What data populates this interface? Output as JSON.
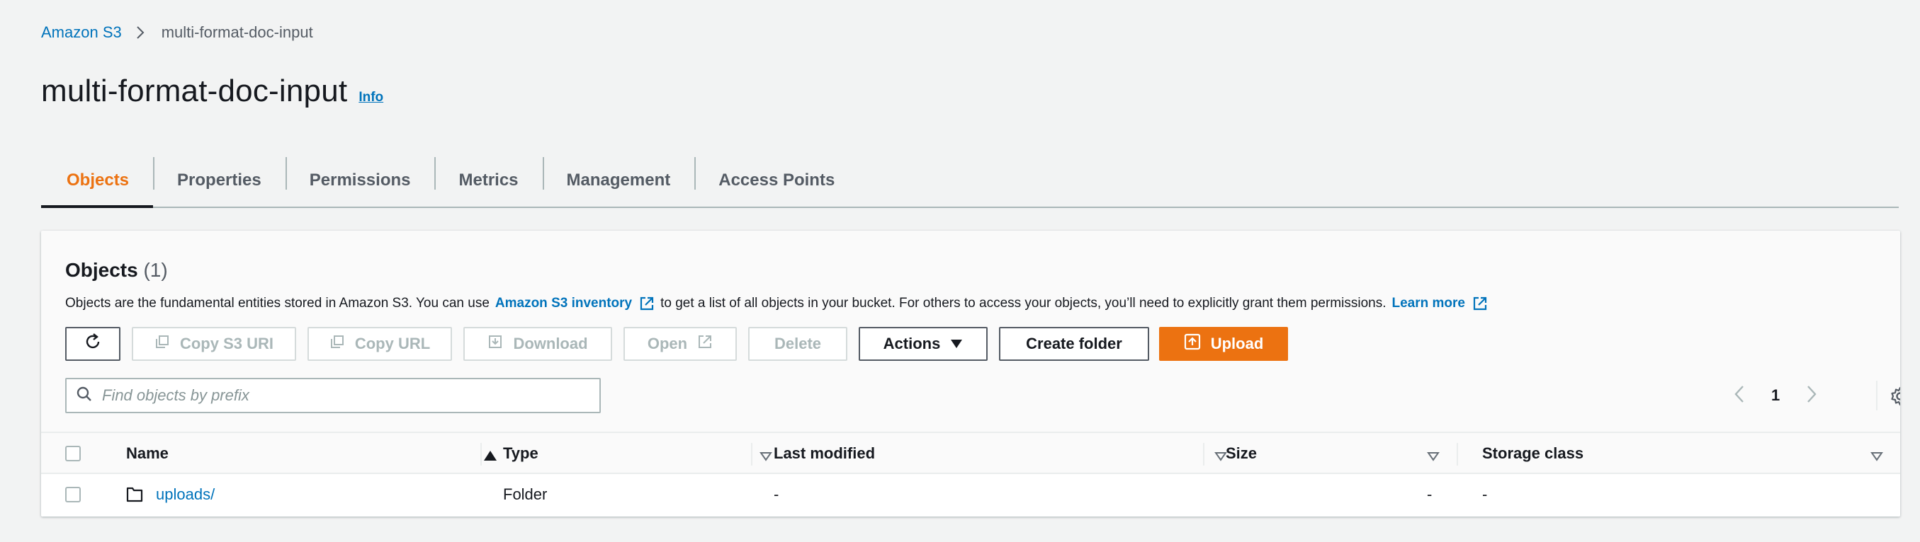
{
  "breadcrumb": {
    "root": "Amazon S3",
    "current": "multi-format-doc-input"
  },
  "header": {
    "title": "multi-format-doc-input",
    "info": "Info"
  },
  "tabs": [
    {
      "label": "Objects",
      "active": true
    },
    {
      "label": "Properties"
    },
    {
      "label": "Permissions"
    },
    {
      "label": "Metrics"
    },
    {
      "label": "Management"
    },
    {
      "label": "Access Points"
    }
  ],
  "objects": {
    "heading": "Objects",
    "count": "(1)",
    "desc_prefix": "Objects are the fundamental entities stored in Amazon S3. You can use",
    "desc_link": "Amazon S3 inventory",
    "desc_middle": "to get a list of all objects in your bucket. For others to access your objects, you’ll need to explicitly grant them permissions.",
    "desc_learn": "Learn more"
  },
  "toolbar": {
    "copy_uri": "Copy S3 URI",
    "copy_url": "Copy URL",
    "download": "Download",
    "open": "Open",
    "delete": "Delete",
    "actions": "Actions",
    "create_folder": "Create folder",
    "upload": "Upload"
  },
  "search": {
    "placeholder": "Find objects by prefix"
  },
  "pagination": {
    "page": "1"
  },
  "table": {
    "columns": [
      "Name",
      "Type",
      "Last modified",
      "Size",
      "Storage class"
    ],
    "rows": [
      {
        "name": "uploads/",
        "type": "Folder",
        "last_modified": "-",
        "size": "-",
        "storage_class": "-"
      }
    ]
  },
  "colors": {
    "accent": "#ec7211",
    "link": "#0073bb",
    "text": "#16191f",
    "muted": "#545b64",
    "background": "#f2f3f3"
  }
}
